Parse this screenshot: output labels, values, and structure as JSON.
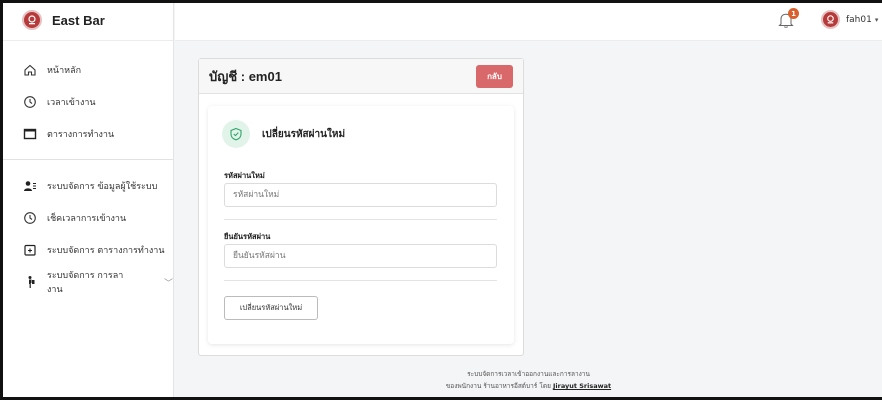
{
  "app": {
    "name": "East Bar"
  },
  "sidebar": {
    "group1": [
      {
        "label": "หน้าหลัก",
        "icon": "home-icon"
      },
      {
        "label": "เวลาเข้างาน",
        "icon": "clock-icon"
      },
      {
        "label": "ตารางการทำงาน",
        "icon": "table-icon"
      }
    ],
    "group2": [
      {
        "label": "ระบบจัดการ ข้อมูลผู้ใช้ระบบ",
        "icon": "users-icon"
      },
      {
        "label": "เช็คเวลาการเข้างาน",
        "icon": "clock-icon"
      },
      {
        "label": "ระบบจัดการ ตารางการทำงาน",
        "icon": "calendar-plus-icon"
      },
      {
        "label": "ระบบจัดการ การลางาน",
        "icon": "person-walking-icon"
      }
    ]
  },
  "topbar": {
    "notification_count": "1",
    "username": "fah01"
  },
  "card": {
    "title": "บัญชี : em01",
    "back_label": "กลับ",
    "section_title": "เปลี่ยนรหัสผ่านใหม่",
    "new_password_label": "รหัสผ่านใหม่",
    "new_password_placeholder": "รหัสผ่านใหม่",
    "confirm_label": "ยืนยันรหัสผ่าน",
    "confirm_placeholder": "ยืนยันรหัสผ่าน",
    "submit_label": "เปลี่ยนรหัสผ่านใหม่"
  },
  "footer": {
    "line1": "ระบบจัดการเวลาเข้าออกงานและการลางาน",
    "line2_prefix": "ของพนักงาน ร้านอาหารอีสต์บาร์ โดย",
    "author": "Jirayut Srisawat"
  },
  "colors": {
    "accent_red": "#d9686a",
    "brand_red": "#b63a3a",
    "success_green": "#2fa36b",
    "badge_orange": "#d9602c"
  }
}
